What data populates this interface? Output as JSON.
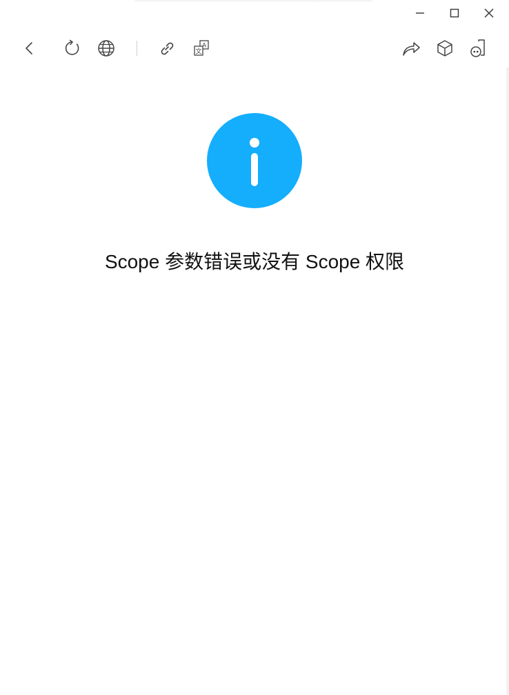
{
  "window": {
    "controls": {
      "minimize_icon": "minimize-icon",
      "maximize_icon": "maximize-icon",
      "close_icon": "close-icon"
    }
  },
  "toolbar": {
    "left": [
      {
        "icon": "back-icon"
      },
      {
        "icon": "refresh-icon"
      },
      {
        "icon": "globe-icon"
      },
      {
        "icon": "link-icon"
      },
      {
        "icon": "translate-icon"
      }
    ],
    "right": [
      {
        "icon": "share-icon"
      },
      {
        "icon": "cube-icon"
      },
      {
        "icon": "mini-program-icon"
      }
    ]
  },
  "content": {
    "status_icon": "info-icon",
    "accent_color": "#14aefd",
    "message": "Scope 参数错误或没有 Scope 权限"
  }
}
